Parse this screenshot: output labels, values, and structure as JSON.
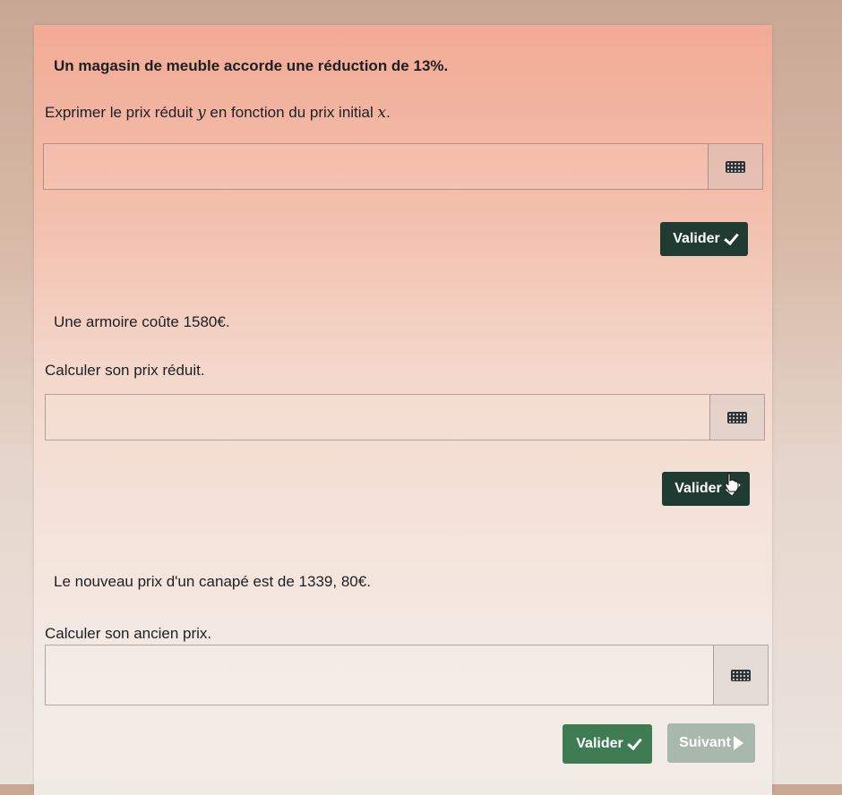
{
  "q1": {
    "statement": "Un magasin de meuble accorde une réduction de 13%.",
    "prompt_a": "Exprimer le prix réduit ",
    "var_y": "y",
    "prompt_b": " en fonction du prix initial ",
    "var_x": "x",
    "prompt_c": ".",
    "input_value": "",
    "button_label": "Valider"
  },
  "q2": {
    "statement": "Une armoire coûte 1580€.",
    "prompt": "Calculer son prix réduit.",
    "input_value": "",
    "button_label": "Valider"
  },
  "q3": {
    "statement": "Le nouveau prix d'un canapé est de 1339, 80€.",
    "prompt": "Calculer son ancien prix.",
    "input_value": "",
    "button_label": "Valider",
    "next_label": "Suivant"
  },
  "icons": {
    "keyboard": "keyboard-icon",
    "check": "check-icon",
    "next": "play-icon",
    "cursor": "hand-cursor-icon"
  },
  "colors": {
    "button_dark": "#203b31",
    "button_green": "#3f7b53",
    "button_disabled": "#a9b8ad"
  }
}
